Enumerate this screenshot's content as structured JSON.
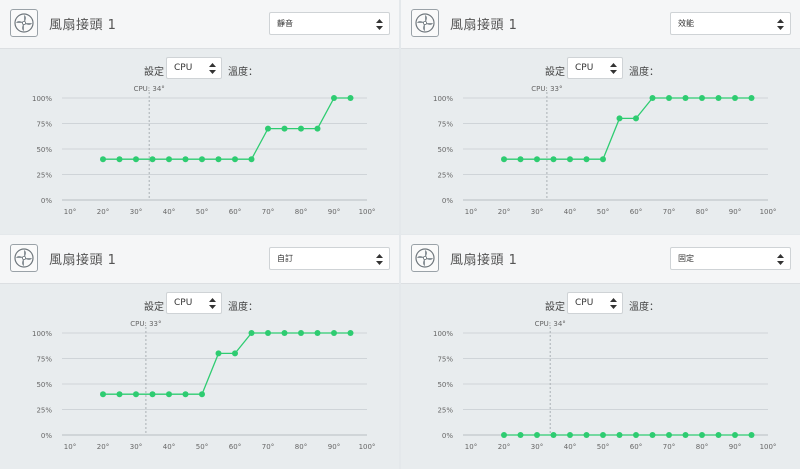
{
  "labels": {
    "setting": "設定",
    "temperature": "溫度："
  },
  "colors": {
    "curve": "#2ecc71",
    "grid": "#cfd4d8",
    "axis": "#b9bec2",
    "text": "#666666"
  },
  "panels": [
    {
      "title": "風扇接頭 1",
      "mode": "靜音",
      "source": "CPU",
      "cpu_temp_label": "CPU: 34°",
      "cpu_temp": 34,
      "fan_icon": "fan-icon",
      "chart_data": {
        "type": "line",
        "x_ticks": [
          "10°",
          "20°",
          "30°",
          "40°",
          "50°",
          "60°",
          "70°",
          "80°",
          "90°",
          "100°"
        ],
        "y_ticks": [
          "0%",
          "25%",
          "50%",
          "75%",
          "100%"
        ],
        "xlim": [
          10,
          100
        ],
        "ylim": [
          0,
          100
        ],
        "x": [
          20,
          25,
          30,
          35,
          40,
          45,
          50,
          55,
          60,
          65,
          70,
          75,
          80,
          85,
          90,
          95
        ],
        "values": [
          40,
          40,
          40,
          40,
          40,
          40,
          40,
          40,
          40,
          40,
          70,
          70,
          70,
          70,
          100,
          100
        ]
      }
    },
    {
      "title": "風扇接頭 1",
      "mode": "效能",
      "source": "CPU",
      "cpu_temp_label": "CPU: 33°",
      "cpu_temp": 33,
      "fan_icon": "fan-icon",
      "chart_data": {
        "type": "line",
        "x_ticks": [
          "10°",
          "20°",
          "30°",
          "40°",
          "50°",
          "60°",
          "70°",
          "80°",
          "90°",
          "100°"
        ],
        "y_ticks": [
          "0%",
          "25%",
          "50%",
          "75%",
          "100%"
        ],
        "xlim": [
          10,
          100
        ],
        "ylim": [
          0,
          100
        ],
        "x": [
          20,
          25,
          30,
          35,
          40,
          45,
          50,
          55,
          60,
          65,
          70,
          75,
          80,
          85,
          90,
          95
        ],
        "values": [
          40,
          40,
          40,
          40,
          40,
          40,
          40,
          80,
          80,
          100,
          100,
          100,
          100,
          100,
          100,
          100
        ]
      }
    },
    {
      "title": "風扇接頭 1",
      "mode": "自訂",
      "source": "CPU",
      "cpu_temp_label": "CPU: 33°",
      "cpu_temp": 33,
      "fan_icon": "fan-icon",
      "chart_data": {
        "type": "line",
        "x_ticks": [
          "10°",
          "20°",
          "30°",
          "40°",
          "50°",
          "60°",
          "70°",
          "80°",
          "90°",
          "100°"
        ],
        "y_ticks": [
          "0%",
          "25%",
          "50%",
          "75%",
          "100%"
        ],
        "xlim": [
          10,
          100
        ],
        "ylim": [
          0,
          100
        ],
        "x": [
          20,
          25,
          30,
          35,
          40,
          45,
          50,
          55,
          60,
          65,
          70,
          75,
          80,
          85,
          90,
          95
        ],
        "values": [
          40,
          40,
          40,
          40,
          40,
          40,
          40,
          80,
          80,
          100,
          100,
          100,
          100,
          100,
          100,
          100
        ]
      }
    },
    {
      "title": "風扇接頭 1",
      "mode": "固定",
      "source": "CPU",
      "cpu_temp_label": "CPU: 34°",
      "cpu_temp": 34,
      "fan_icon": "fan-icon",
      "chart_data": {
        "type": "line",
        "x_ticks": [
          "10°",
          "20°",
          "30°",
          "40°",
          "50°",
          "60°",
          "70°",
          "80°",
          "90°",
          "100°"
        ],
        "y_ticks": [
          "0%",
          "25%",
          "50%",
          "75%",
          "100%"
        ],
        "xlim": [
          10,
          100
        ],
        "ylim": [
          0,
          100
        ],
        "x": [
          20,
          25,
          30,
          35,
          40,
          45,
          50,
          55,
          60,
          65,
          70,
          75,
          80,
          85,
          90,
          95
        ],
        "values": [
          0,
          0,
          0,
          0,
          0,
          0,
          0,
          0,
          0,
          0,
          0,
          0,
          0,
          0,
          0,
          0
        ]
      }
    }
  ]
}
